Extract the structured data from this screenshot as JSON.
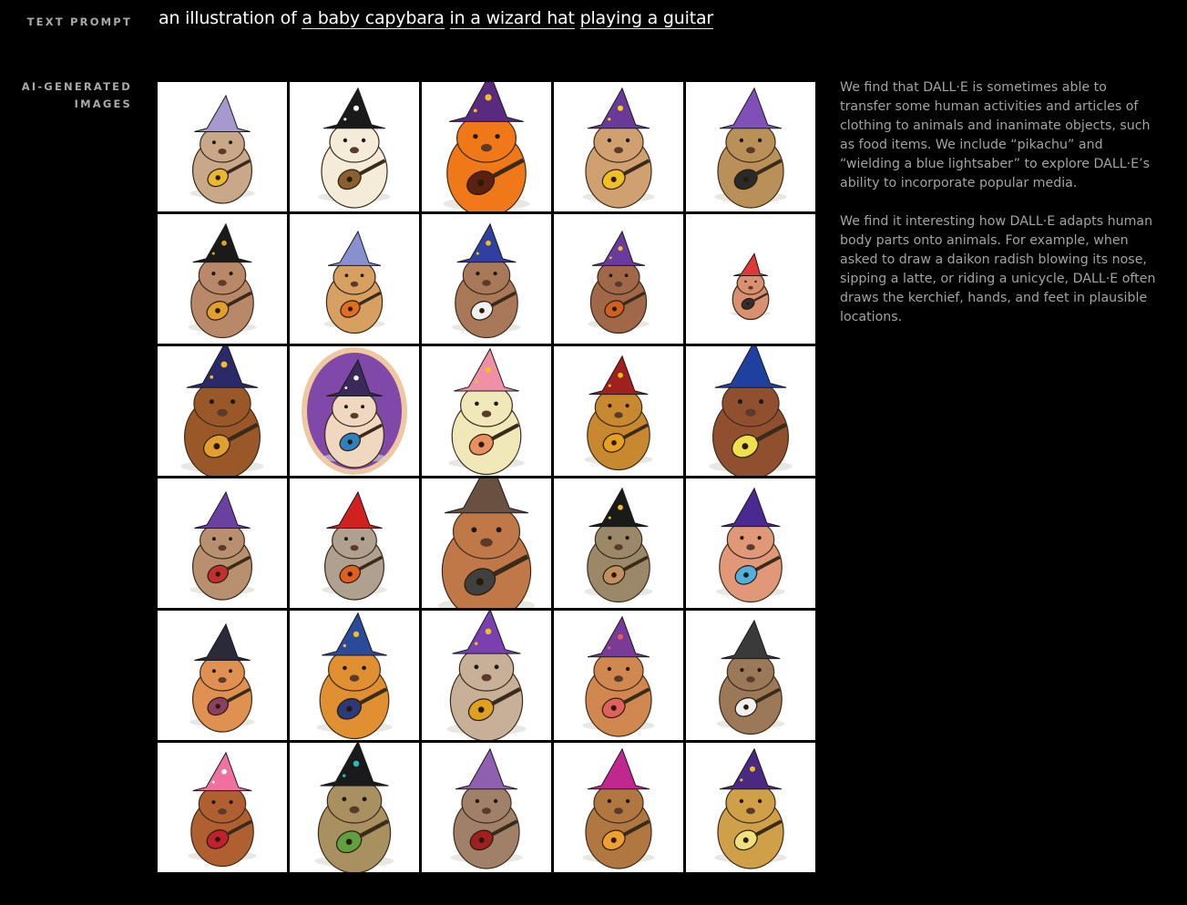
{
  "labels": {
    "text_prompt": "TEXT PROMPT",
    "ai_generated": "AI-GENERATED IMAGES"
  },
  "prompt": {
    "prefix": "an illustration of ",
    "segments": [
      "a baby capybara",
      "in a wizard hat",
      "playing a guitar"
    ]
  },
  "description": {
    "paragraphs": [
      "We find that DALL·E is sometimes able to transfer some human activities and articles of clothing to animals and inanimate objects, such as food items. We include “pikachu” and “wielding a blue lightsaber” to explore DALL·E’s ability to incorporate popular media.",
      "We find it interesting how DALL·E adapts human body parts onto animals. For example, when asked to draw a daikon radish blowing its nose, sipping a latte, or riding a unicycle, DALL·E often draws the kerchief, hands, and feet in plausible locations."
    ]
  },
  "images": [
    {
      "body": "#c8a888",
      "hat": "#a898d0",
      "guitar": "#e8b830",
      "bg": "#ffffff",
      "star": "#a898d0",
      "scale": 0.9
    },
    {
      "body": "#f4ecd8",
      "hat": "#1a1a1a",
      "guitar": "#8a6030",
      "bg": "#ffffff",
      "star": "#ffffff",
      "scale": 1.0
    },
    {
      "body": "#f07818",
      "hat": "#5a2a80",
      "guitar": "#5a2010",
      "bg": "#ffffff",
      "star": "#f0c020",
      "scale": 1.2
    },
    {
      "body": "#d0a070",
      "hat": "#6a3a98",
      "guitar": "#f0c020",
      "bg": "#ffffff",
      "star": "#f8d020",
      "scale": 1.0
    },
    {
      "body": "#b89058",
      "hat": "#8050b8",
      "guitar": "#2a2a2a",
      "bg": "#ffffff",
      "star": "#8050b8",
      "scale": 1.0
    },
    {
      "body": "#b88868",
      "hat": "#1a1a1a",
      "guitar": "#e0a030",
      "bg": "#ffffff",
      "star": "#e0a030",
      "scale": 0.95
    },
    {
      "body": "#d8a060",
      "hat": "#8890d0",
      "guitar": "#e07020",
      "bg": "#ffffff",
      "star": "#8890d0",
      "scale": 0.85
    },
    {
      "body": "#a87858",
      "hat": "#3040a0",
      "guitar": "#f0f0f0",
      "bg": "#ffffff",
      "star": "#f0c020",
      "scale": 0.95
    },
    {
      "body": "#a06848",
      "hat": "#6a3aa0",
      "guitar": "#d06020",
      "bg": "#ffffff",
      "star": "#f0c020",
      "scale": 0.85
    },
    {
      "body": "#d89070",
      "hat": "#e03838",
      "guitar": "#303030",
      "bg": "#ffffff",
      "star": "#e03838",
      "scale": 0.55
    },
    {
      "body": "#9a5828",
      "hat": "#2a2a6a",
      "guitar": "#e0a030",
      "bg": "#ffffff",
      "star": "#f0c020",
      "scale": 1.15
    },
    {
      "body": "#f0d8c0",
      "hat": "#3a2a5a",
      "guitar": "#3080c0",
      "bg": "#8048a8",
      "star": "#ffffff",
      "scale": 0.9
    },
    {
      "body": "#f0e8b8",
      "hat": "#f090a8",
      "guitar": "#e89060",
      "bg": "#ffffff",
      "star": "#f0c020",
      "scale": 1.05
    },
    {
      "body": "#c88830",
      "hat": "#a02020",
      "guitar": "#e8a020",
      "bg": "#ffffff",
      "star": "#f0c020",
      "scale": 0.95
    },
    {
      "body": "#905030",
      "hat": "#2040a0",
      "guitar": "#f0e050",
      "bg": "#ffffff",
      "star": "#2040a0",
      "scale": 1.15
    },
    {
      "body": "#b89070",
      "hat": "#6a40a0",
      "guitar": "#c03030",
      "bg": "#ffffff",
      "star": "#6a40a0",
      "scale": 0.9
    },
    {
      "body": "#b0a090",
      "hat": "#d02020",
      "guitar": "#e06020",
      "bg": "#ffffff",
      "star": "#d02020",
      "scale": 0.9
    },
    {
      "body": "#c07848",
      "hat": "#6a5040",
      "guitar": "#404040",
      "bg": "#ffffff",
      "star": "#6a5040",
      "scale": 1.35
    },
    {
      "body": "#9a8868",
      "hat": "#1a1a1a",
      "guitar": "#c09060",
      "bg": "#ffffff",
      "star": "#f0c020",
      "scale": 0.95
    },
    {
      "body": "#e09878",
      "hat": "#4a2a90",
      "guitar": "#50b0e0",
      "bg": "#ffffff",
      "star": "#4a2a90",
      "scale": 0.95
    },
    {
      "body": "#e09050",
      "hat": "#2a2a3a",
      "guitar": "#8a4060",
      "bg": "#ffffff",
      "star": "#2a2a3a",
      "scale": 0.9
    },
    {
      "body": "#e09030",
      "hat": "#2a4a9a",
      "guitar": "#2a3a7a",
      "bg": "#ffffff",
      "star": "#f0c020",
      "scale": 1.05
    },
    {
      "body": "#c8b098",
      "hat": "#7a40b0",
      "guitar": "#e0a020",
      "bg": "#ffffff",
      "star": "#f0c020",
      "scale": 1.1
    },
    {
      "body": "#d08850",
      "hat": "#7a3a98",
      "guitar": "#e06060",
      "bg": "#ffffff",
      "star": "#e06060",
      "scale": 1.0
    },
    {
      "body": "#9a7858",
      "hat": "#3a3a3a",
      "guitar": "#f0f0f0",
      "bg": "#ffffff",
      "star": "#3a3a3a",
      "scale": 0.95
    },
    {
      "body": "#b06030",
      "hat": "#f070a0",
      "guitar": "#c02030",
      "bg": "#ffffff",
      "star": "#ffffff",
      "scale": 0.95
    },
    {
      "body": "#a89060",
      "hat": "#1a1a1a",
      "guitar": "#60a040",
      "bg": "#ffffff",
      "star": "#20c0b0",
      "scale": 1.1
    },
    {
      "body": "#a08068",
      "hat": "#9060b0",
      "guitar": "#a02020",
      "bg": "#ffffff",
      "star": "#9060b0",
      "scale": 1.0
    },
    {
      "body": "#b07840",
      "hat": "#c02890",
      "guitar": "#f0a030",
      "bg": "#ffffff",
      "star": "#c02890",
      "scale": 1.0
    },
    {
      "body": "#d0a048",
      "hat": "#4a2a80",
      "guitar": "#f0e080",
      "bg": "#ffffff",
      "star": "#f0c020",
      "scale": 1.0
    }
  ]
}
